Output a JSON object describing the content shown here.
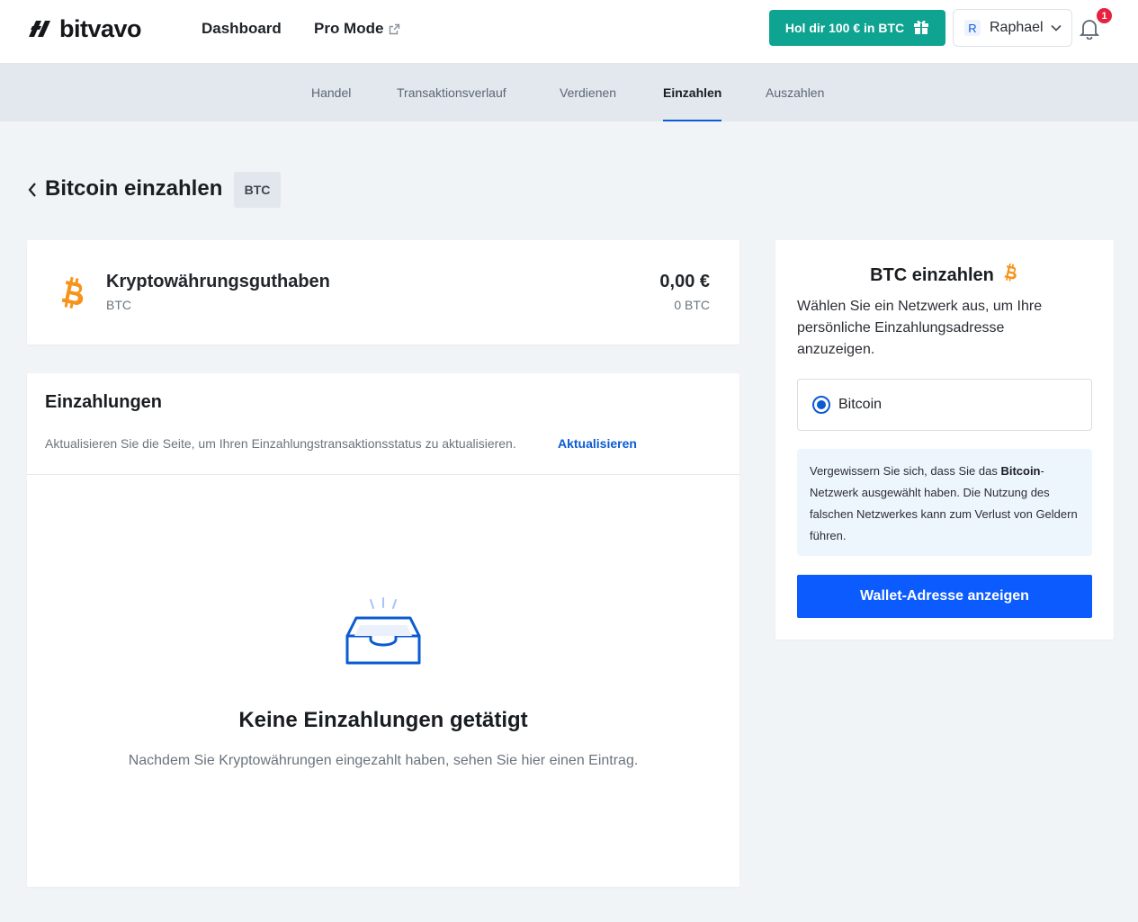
{
  "header": {
    "logo_text": "bitvavo",
    "nav": {
      "dashboard": "Dashboard",
      "pro_mode": "Pro Mode"
    },
    "promo_label": "Hol dir 100 € in BTC",
    "user": {
      "initial": "R",
      "name": "Raphael"
    },
    "notification_count": "1"
  },
  "subnav": {
    "tabs": [
      {
        "label": "Handel"
      },
      {
        "label": "Transaktionsverlauf"
      },
      {
        "label": "Verdienen"
      },
      {
        "label": "Einzahlen"
      },
      {
        "label": "Auszahlen"
      }
    ],
    "active_tab": "Einzahlen"
  },
  "page": {
    "title": "Bitcoin einzahlen",
    "badge": "BTC"
  },
  "balance": {
    "name": "Kryptowährungsguthaben",
    "symbol": "BTC",
    "value_eur": "0,00 €",
    "value_btc": "0 BTC"
  },
  "deposits": {
    "title": "Einzahlungen",
    "hint": "Aktualisieren Sie die Seite, um Ihren Einzahlungstransaktionsstatus zu aktualisieren.",
    "refresh_label": "Aktualisieren",
    "empty_title": "Keine Einzahlungen getätigt",
    "empty_subtitle": "Nachdem Sie Kryptowährungen eingezahlt haben, sehen Sie hier einen Eintrag."
  },
  "deposit_panel": {
    "title": "BTC einzahlen",
    "description": "Wählen Sie ein Netzwerk aus, um Ihre persönliche Einzahlungsadresse anzuzeigen.",
    "network_option": "Bitcoin",
    "warning_prefix": "Vergewissern Sie sich, dass Sie das ",
    "warning_network": "Bitcoin",
    "warning_suffix": "-Netzwerk ausgewählt haben. Die Nutzung des falschen Netzwerkes kann zum Verlust von Geldern führen.",
    "button_label": "Wallet-Adresse anzeigen"
  },
  "colors": {
    "accent_blue": "#0b5bff",
    "promo_green": "#0fa391",
    "bitcoin_orange": "#f7931a",
    "badge_red": "#e8213f"
  }
}
